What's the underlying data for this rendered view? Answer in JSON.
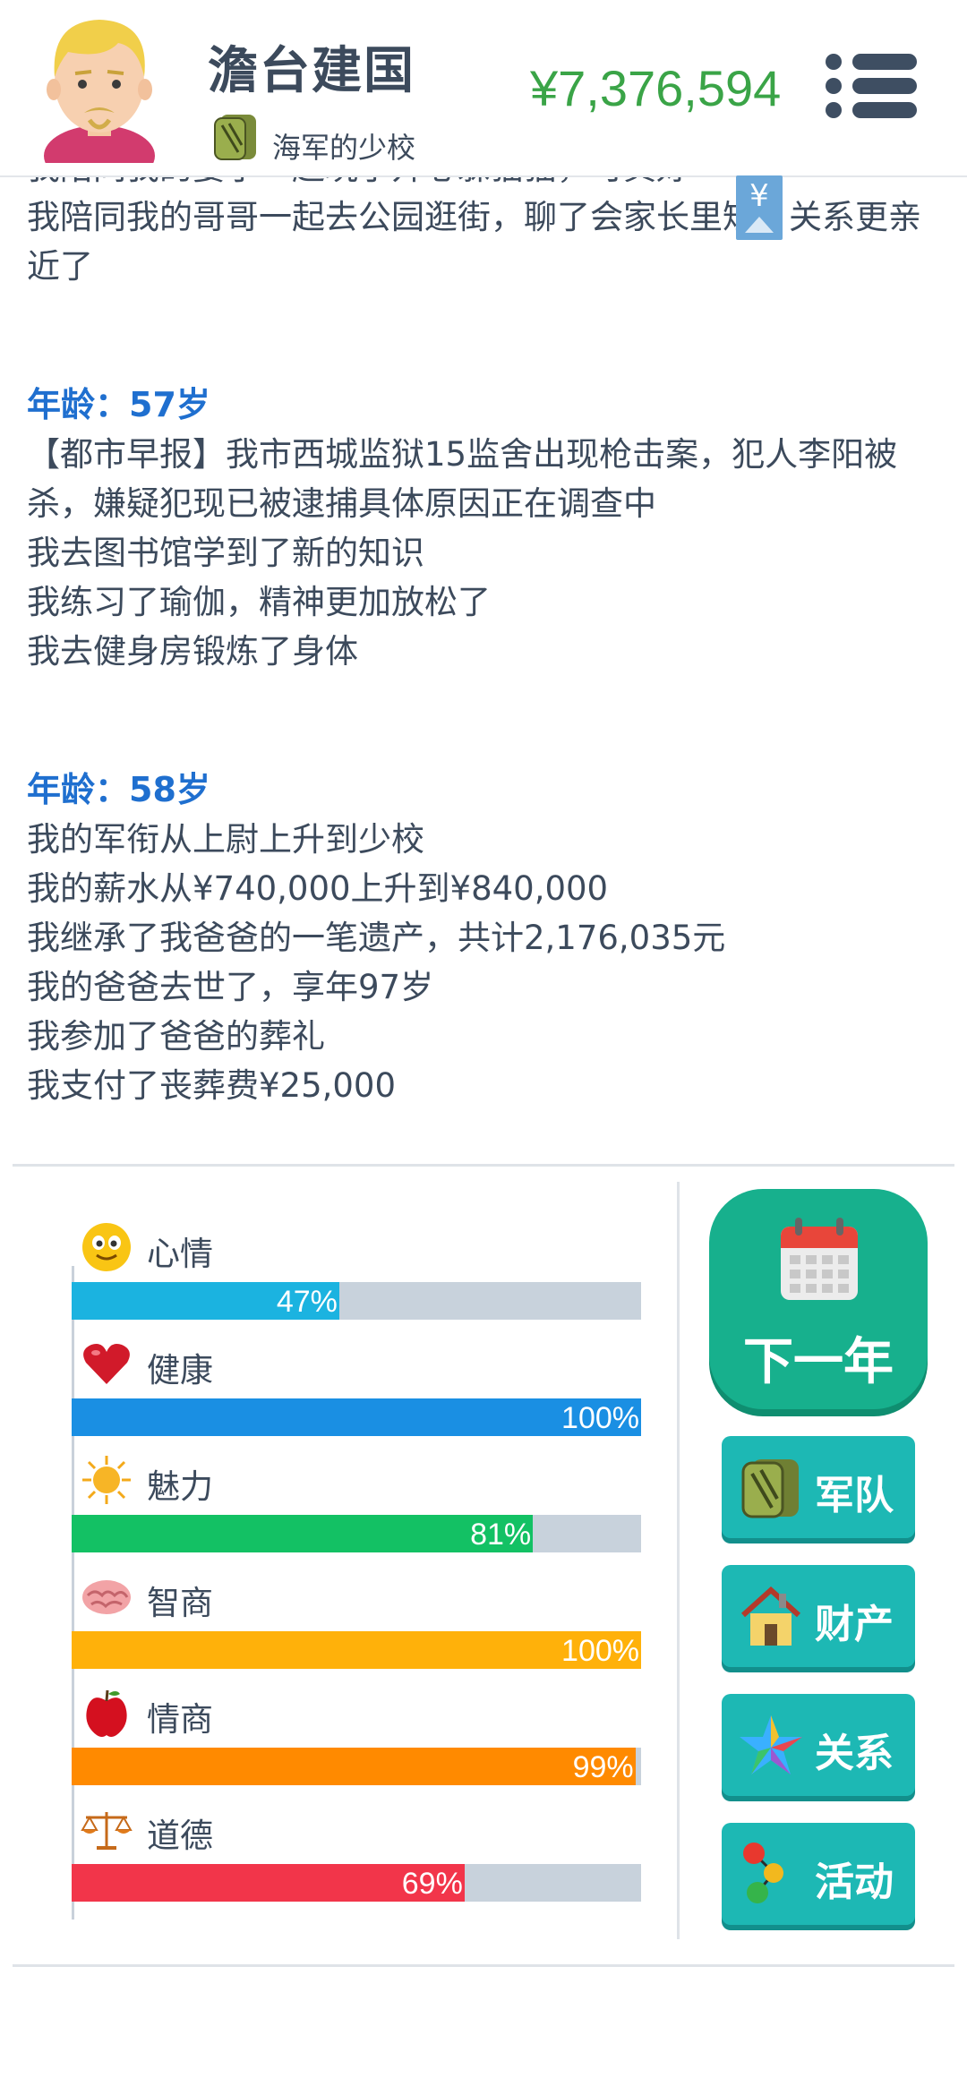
{
  "header": {
    "name": "澹台建国",
    "rank": "海军的少校",
    "money": "¥7,376,594",
    "floating_badge": "¥"
  },
  "log": {
    "line_cut": "我陪同我的妻子一起玩了开心躲猫猫，可真好",
    "line_1": "我陪同我的哥哥一起去公园逛街，聊了会家长里短，关系更亲近了",
    "age_57": "年龄：57岁",
    "l57_1": "【都市早报】我市西城监狱15监舍出现枪击案，犯人李阳被杀，嫌疑犯现已被逮捕具体原因正在调查中",
    "l57_2": "我去图书馆学到了新的知识",
    "l57_3": "我练习了瑜伽，精神更加放松了",
    "l57_4": "我去健身房锻炼了身体",
    "age_58": "年龄：58岁",
    "l58_1": "我的军衔从上尉上升到少校",
    "l58_2": "我的薪水从¥740,000上升到¥840,000",
    "l58_3": "我继承了我爸爸的一笔遗产，共计2,176,035元",
    "l58_4": "我的爸爸去世了，享年97岁",
    "l58_5": "我参加了爸爸的葬礼",
    "l58_6": "我支付了丧葬费¥25,000"
  },
  "stats": [
    {
      "label": "心情",
      "value": 47,
      "pct": "47%",
      "color": "#1bb3e0",
      "icon": "smiley-face-icon"
    },
    {
      "label": "健康",
      "value": 100,
      "pct": "100%",
      "color": "#1a8fe3",
      "icon": "heart-icon"
    },
    {
      "label": "魅力",
      "value": 81,
      "pct": "81%",
      "color": "#13c164",
      "icon": "sun-icon"
    },
    {
      "label": "智商",
      "value": 100,
      "pct": "100%",
      "color": "#ffb10a",
      "icon": "brain-icon"
    },
    {
      "label": "情商",
      "value": 99,
      "pct": "99%",
      "color": "#ff8a00",
      "icon": "apple-icon"
    },
    {
      "label": "道德",
      "value": 69,
      "pct": "69%",
      "color": "#f2354a",
      "icon": "scales-icon"
    }
  ],
  "actions": {
    "next_year": "下一年",
    "army": "军队",
    "property": "财产",
    "relations": "关系",
    "activities": "活动"
  }
}
